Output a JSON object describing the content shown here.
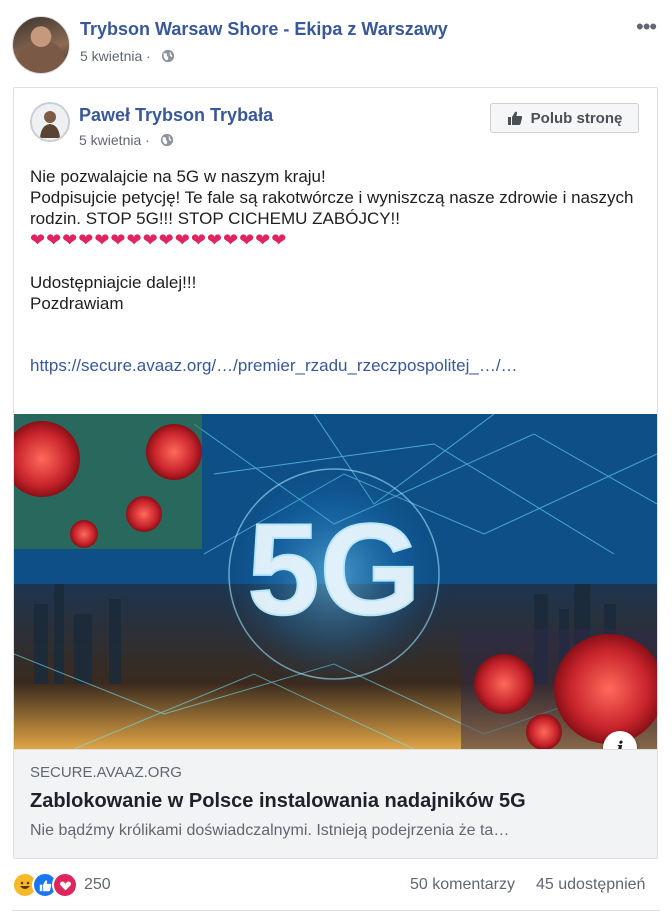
{
  "post": {
    "page_name": "Trybson Warsaw Shore - Ekipa z Warszawy",
    "date": "5 kwietnia",
    "more_label": "•••"
  },
  "shared": {
    "author": "Paweł Trybson Trybała",
    "date": "5 kwietnia",
    "like_page_label": "Polub stronę",
    "text_lines": [
      "Nie pozwalajcie na 5G w naszym kraju!",
      "Podpisujcie petycję! Te fale są rakotwórcze i wyniszczą nasze zdrowie i naszych rodzin. STOP 5G!!! STOP CICHEMU ZABÓJCY!!"
    ],
    "hearts": "❤❤❤❤❤❤❤❤❤❤❤❤❤❤❤❤",
    "closing_lines": [
      "Udostępniajcie dalej!!!",
      "Pozdrawiam"
    ],
    "link_text": "https://secure.avaaz.org/…/premier_rzadu_rzeczpospolitej_…/…"
  },
  "link_preview": {
    "image_text": "5G",
    "domain": "SECURE.AVAAZ.ORG",
    "title": "Zablokowanie w Polsce instalowania nadajników 5G",
    "description": "Nie bądźmy królikami doświadczalnymi. Istnieją podejrzenia że ta…",
    "info_label": "i"
  },
  "footer": {
    "reaction_icons": [
      "haha-icon",
      "like-icon",
      "love-icon"
    ],
    "reaction_count": "250",
    "comments": "50 komentarzy",
    "shares": "45 udostępnień"
  },
  "colors": {
    "link_blue": "#385898",
    "heart_red": "#e0245e",
    "like_blue": "#1877f2",
    "haha_yellow": "#f7b928"
  }
}
